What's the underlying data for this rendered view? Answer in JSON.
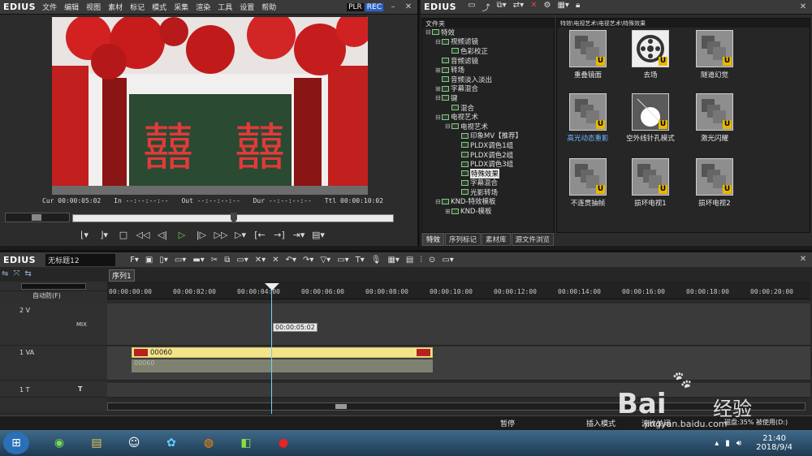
{
  "player": {
    "logo": "EDIUS",
    "menu": [
      "文件",
      "编辑",
      "视图",
      "素材",
      "标记",
      "模式",
      "采集",
      "渲染",
      "工具",
      "设置",
      "帮助"
    ],
    "plr": "PLR",
    "rec": "REC",
    "video_text": {
      "left": "囍",
      "right": "囍"
    },
    "timecodes": {
      "cur": "Cur 00:00:05:02",
      "in": "In --:--:--:--",
      "out": "Out --:--:--:--",
      "dur": "Dur --:--:--:--",
      "ttl": "Ttl 00:00:10:02"
    }
  },
  "bin": {
    "logo": "EDIUS",
    "tree_header": "文件夹",
    "path": "特效\\电视艺术\\电视艺术\\特殊效果",
    "tree": [
      {
        "label": "特效",
        "ex": "⊟",
        "indent": 0
      },
      {
        "label": "视频滤镜",
        "ex": "⊟",
        "indent": 1
      },
      {
        "label": "色彩校正",
        "ex": "",
        "indent": 2
      },
      {
        "label": "音频滤镜",
        "ex": "",
        "indent": 1
      },
      {
        "label": "转场",
        "ex": "⊞",
        "indent": 1
      },
      {
        "label": "音频淡入淡出",
        "ex": "",
        "indent": 1
      },
      {
        "label": "字幕混合",
        "ex": "⊞",
        "indent": 1
      },
      {
        "label": "键",
        "ex": "⊟",
        "indent": 1
      },
      {
        "label": "混合",
        "ex": "",
        "indent": 2
      },
      {
        "label": "电视艺术",
        "ex": "⊟",
        "indent": 1
      },
      {
        "label": "电视艺术",
        "ex": "⊟",
        "indent": 2
      },
      {
        "label": "印象MV【推荐】",
        "ex": "",
        "indent": 3
      },
      {
        "label": "PLDX调色1组",
        "ex": "",
        "indent": 3
      },
      {
        "label": "PLDX调色2组",
        "ex": "",
        "indent": 3
      },
      {
        "label": "PLDX调色3组",
        "ex": "",
        "indent": 3
      },
      {
        "label": "特殊效果",
        "ex": "",
        "indent": 3,
        "selected": true
      },
      {
        "label": "字幕混合",
        "ex": "",
        "indent": 3
      },
      {
        "label": "光影转场",
        "ex": "",
        "indent": 3
      },
      {
        "label": "KND-特效模板",
        "ex": "⊟",
        "indent": 1
      },
      {
        "label": "KND-模板",
        "ex": "⊞",
        "indent": 2
      }
    ],
    "effects": [
      "重叠镜面",
      "去场",
      "隧道幻觉",
      "高光动态重影",
      "空外线针孔模式",
      "激光闪耀",
      "不连贯抽帧",
      "损坏电视1",
      "损坏电视2"
    ],
    "selected_effect": "高光动态重影",
    "tabs": [
      "特效",
      "序列标记",
      "素材库",
      "源文件浏览"
    ]
  },
  "timeline": {
    "logo": "EDIUS",
    "project": "无标题12",
    "sequence_tab": "序列1",
    "mode": "自动防(F)",
    "ruler": [
      "00:00:00:00",
      "00:00:02:00",
      "00:00:04:00",
      "00:00:06:00",
      "00:00:08:00",
      "00:00:10:00",
      "00:00:12:00",
      "00:00:14:00",
      "00:00:16:00",
      "00:00:18:00",
      "00:00:20:00"
    ],
    "tracks": [
      {
        "name": "2 V",
        "mix": "MIX"
      },
      {
        "name": "1 VA"
      },
      {
        "name": "1 T"
      }
    ],
    "clip_label": "00060",
    "clip_audio_label": "00060",
    "tooltip": "00:00:05:02"
  },
  "status": {
    "pause": "暂停",
    "insert": "插入模式",
    "ripple": "波纹关闭",
    "disk": "磁盘:35% 被使用(D:)"
  },
  "taskbar": {
    "time": "21:40",
    "date": "2018/9/4"
  },
  "watermark": {
    "brand": "Bai",
    "brand2": "经验",
    "url": "jingyan.baidu.com"
  }
}
